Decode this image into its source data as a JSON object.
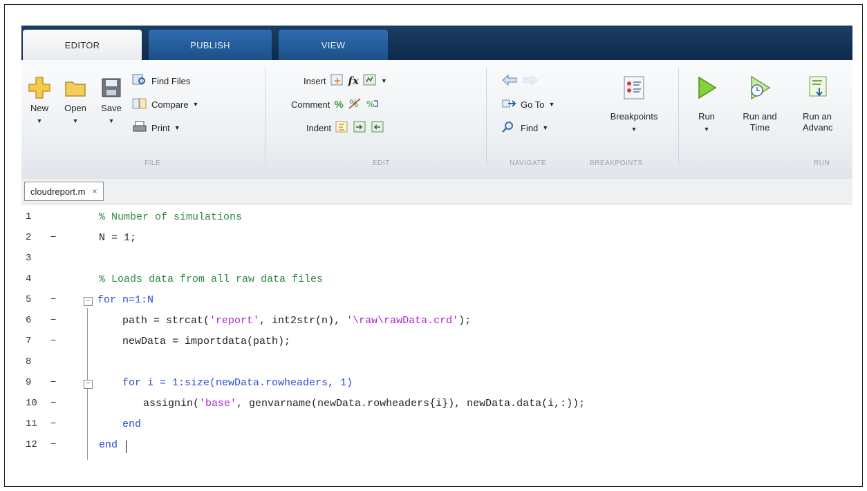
{
  "tabs": [
    {
      "label": "EDITOR",
      "active": true
    },
    {
      "label": "PUBLISH",
      "active": false
    },
    {
      "label": "VIEW",
      "active": false
    }
  ],
  "ribbon": {
    "file": {
      "group_label": "FILE",
      "new": "New",
      "open": "Open",
      "save": "Save",
      "find_files": "Find Files",
      "compare": "Compare",
      "print": "Print"
    },
    "edit": {
      "group_label": "EDIT",
      "insert": "Insert",
      "comment": "Comment",
      "indent": "Indent"
    },
    "navigate": {
      "group_label": "NAVIGATE",
      "go_to": "Go To",
      "find": "Find"
    },
    "breakpoints": {
      "group_label": "BREAKPOINTS",
      "label": "Breakpoints"
    },
    "run": {
      "group_label": "RUN",
      "run": "Run",
      "run_and_time_1": "Run and",
      "run_and_time_2": "Time",
      "run_advance_1": "Run an",
      "run_advance_2": "Advanc"
    }
  },
  "document_tab": {
    "filename": "cloudreport.m",
    "close": "×"
  },
  "editor": {
    "lines": [
      {
        "n": "1",
        "dash": "",
        "text": "% Number of simulations"
      },
      {
        "n": "2",
        "dash": "−",
        "text": "N = 1;"
      },
      {
        "n": "3",
        "dash": "",
        "text": ""
      },
      {
        "n": "4",
        "dash": "",
        "text": "% Loads data from all raw data files"
      },
      {
        "n": "5",
        "dash": "−",
        "text": "for n=1:N"
      },
      {
        "n": "6",
        "dash": "−",
        "text": "path = strcat('report', int2str(n), '\\raw\\rawData.crd');"
      },
      {
        "n": "7",
        "dash": "−",
        "text": "newData = importdata(path);"
      },
      {
        "n": "8",
        "dash": "",
        "text": ""
      },
      {
        "n": "9",
        "dash": "−",
        "text": "for i = 1:size(newData.rowheaders, 1)"
      },
      {
        "n": "10",
        "dash": "−",
        "text": "assignin('base', genvarname(newData.rowheaders{i}), newData.data(i,:));"
      },
      {
        "n": "11",
        "dash": "−",
        "text": "end"
      },
      {
        "n": "12",
        "dash": "−",
        "text": "end"
      }
    ]
  },
  "colors": {
    "comment": "#2e8b3e",
    "string": "#b024d0",
    "keyword": "#2a4bd6",
    "tabstrip": "#0e2a4d"
  }
}
